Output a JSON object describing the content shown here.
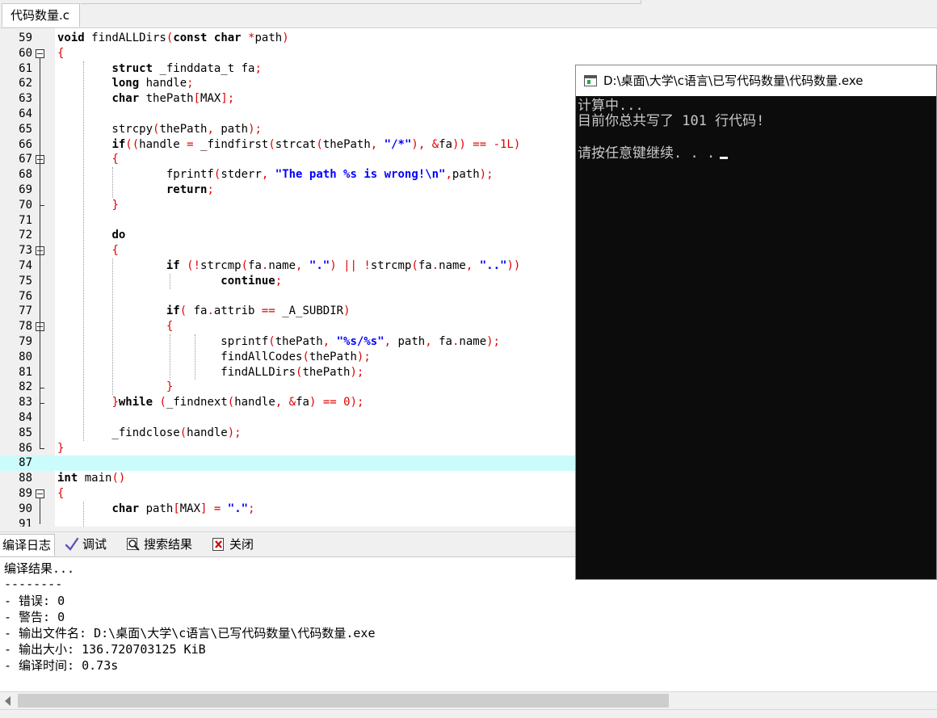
{
  "file_tab": "代码数量.c",
  "code_lines": [
    {
      "n": "59",
      "h": "<span class=\"kw\">void</span> findALLDirs<span class=\"sym\">(</span><span class=\"kw\">const char</span> <span class=\"sym\">*</span>path<span class=\"sym\">)</span>"
    },
    {
      "n": "60",
      "h": "<span class=\"sym\">{</span>"
    },
    {
      "n": "61",
      "h": "        <span class=\"kw\">struct</span> _finddata_t fa<span class=\"sym\">;</span>"
    },
    {
      "n": "62",
      "h": "        <span class=\"kw\">long</span> handle<span class=\"sym\">;</span>"
    },
    {
      "n": "63",
      "h": "        <span class=\"kw\">char</span> thePath<span class=\"sym\">[</span>MAX<span class=\"sym\">];</span>"
    },
    {
      "n": "64",
      "h": ""
    },
    {
      "n": "65",
      "h": "        strcpy<span class=\"sym\">(</span>thePath<span class=\"sym\">,</span> path<span class=\"sym\">);</span>"
    },
    {
      "n": "66",
      "h": "        <span class=\"kw\">if</span><span class=\"sym\">((</span>handle <span class=\"sym\">=</span> _findfirst<span class=\"sym\">(</span>strcat<span class=\"sym\">(</span>thePath<span class=\"sym\">,</span> <span class=\"str\">\"/*\"</span><span class=\"sym\">),</span> <span class=\"sym\">&amp;</span>fa<span class=\"sym\">))</span> <span class=\"sym\">==</span> <span class=\"num\">-1L</span><span class=\"sym\">)</span>"
    },
    {
      "n": "67",
      "h": "        <span class=\"sym\">{</span>"
    },
    {
      "n": "68",
      "h": "                fprintf<span class=\"sym\">(</span>stderr<span class=\"sym\">,</span> <span class=\"str\">\"The path %s is wrong!\\n\"</span><span class=\"sym\">,</span>path<span class=\"sym\">);</span>"
    },
    {
      "n": "69",
      "h": "                <span class=\"kw\">return</span><span class=\"sym\">;</span>"
    },
    {
      "n": "70",
      "h": "        <span class=\"sym\">}</span>"
    },
    {
      "n": "71",
      "h": ""
    },
    {
      "n": "72",
      "h": "        <span class=\"kw\">do</span>"
    },
    {
      "n": "73",
      "h": "        <span class=\"sym\">{</span>"
    },
    {
      "n": "74",
      "h": "                <span class=\"kw\">if</span> <span class=\"sym\">(!</span>strcmp<span class=\"sym\">(</span>fa<span class=\"sym\">.</span>name<span class=\"sym\">,</span> <span class=\"str\">\".\"</span><span class=\"sym\">)</span> <span class=\"sym\">||</span> <span class=\"sym\">!</span>strcmp<span class=\"sym\">(</span>fa<span class=\"sym\">.</span>name<span class=\"sym\">,</span> <span class=\"str\">\"..\"</span><span class=\"sym\">))</span>"
    },
    {
      "n": "75",
      "h": "                        <span class=\"kw\">continue</span><span class=\"sym\">;</span>"
    },
    {
      "n": "76",
      "h": ""
    },
    {
      "n": "77",
      "h": "                <span class=\"kw\">if</span><span class=\"sym\">(</span> fa<span class=\"sym\">.</span>attrib <span class=\"sym\">==</span> _A_SUBDIR<span class=\"sym\">)</span>"
    },
    {
      "n": "78",
      "h": "                <span class=\"sym\">{</span>"
    },
    {
      "n": "79",
      "h": "                        sprintf<span class=\"sym\">(</span>thePath<span class=\"sym\">,</span> <span class=\"str\">\"%s/%s\"</span><span class=\"sym\">,</span> path<span class=\"sym\">,</span> fa<span class=\"sym\">.</span>name<span class=\"sym\">);</span>"
    },
    {
      "n": "80",
      "h": "                        findAllCodes<span class=\"sym\">(</span>thePath<span class=\"sym\">);</span>"
    },
    {
      "n": "81",
      "h": "                        findALLDirs<span class=\"sym\">(</span>thePath<span class=\"sym\">);</span>"
    },
    {
      "n": "82",
      "h": "                <span class=\"sym\">}</span>"
    },
    {
      "n": "83",
      "h": "        <span class=\"sym\">}</span><span class=\"kw\">while</span> <span class=\"sym\">(</span>_findnext<span class=\"sym\">(</span>handle<span class=\"sym\">,</span> <span class=\"sym\">&amp;</span>fa<span class=\"sym\">)</span> <span class=\"sym\">==</span> <span class=\"num\">0</span><span class=\"sym\">);</span>"
    },
    {
      "n": "84",
      "h": ""
    },
    {
      "n": "85",
      "h": "        _findclose<span class=\"sym\">(</span>handle<span class=\"sym\">);</span>"
    },
    {
      "n": "86",
      "h": "<span class=\"sym\">}</span>"
    },
    {
      "n": "87",
      "h": ""
    },
    {
      "n": "88",
      "h": "<span class=\"kw\">int</span> main<span class=\"sym\">()</span>"
    },
    {
      "n": "89",
      "h": "<span class=\"sym\">{</span>"
    },
    {
      "n": "90",
      "h": "        <span class=\"kw\">char</span> path<span class=\"sym\">[</span>MAX<span class=\"sym\">]</span> <span class=\"sym\">=</span> <span class=\"str\">\".\"</span><span class=\"sym\">;</span>"
    },
    {
      "n": "91",
      "h": ""
    }
  ],
  "bottom_tabs": {
    "compile_log": "编译日志",
    "debug": "调试",
    "search_results": "搜索结果",
    "close": "关闭"
  },
  "log": {
    "title": "编译结果...",
    "divider": "--------",
    "errors": "- 错误: 0",
    "warnings": "- 警告: 0",
    "output_file": "- 输出文件名: D:\\桌面\\大学\\c语言\\已写代码数量\\代码数量.exe",
    "output_size": "- 输出大小: 136.720703125 KiB",
    "compile_time": "- 编译时间: 0.73s"
  },
  "console": {
    "title": "D:\\桌面\\大学\\c语言\\已写代码数量\\代码数量.exe",
    "line1": "计算中...",
    "line2": "目前你总共写了 101 行代码!",
    "line3": "请按任意键继续. . ."
  },
  "colors": {
    "keyword": "#000000",
    "symbol": "#e00000",
    "string": "#0000ff",
    "current_line": "#ccfbfb",
    "console_bg": "#0c0c0c"
  }
}
